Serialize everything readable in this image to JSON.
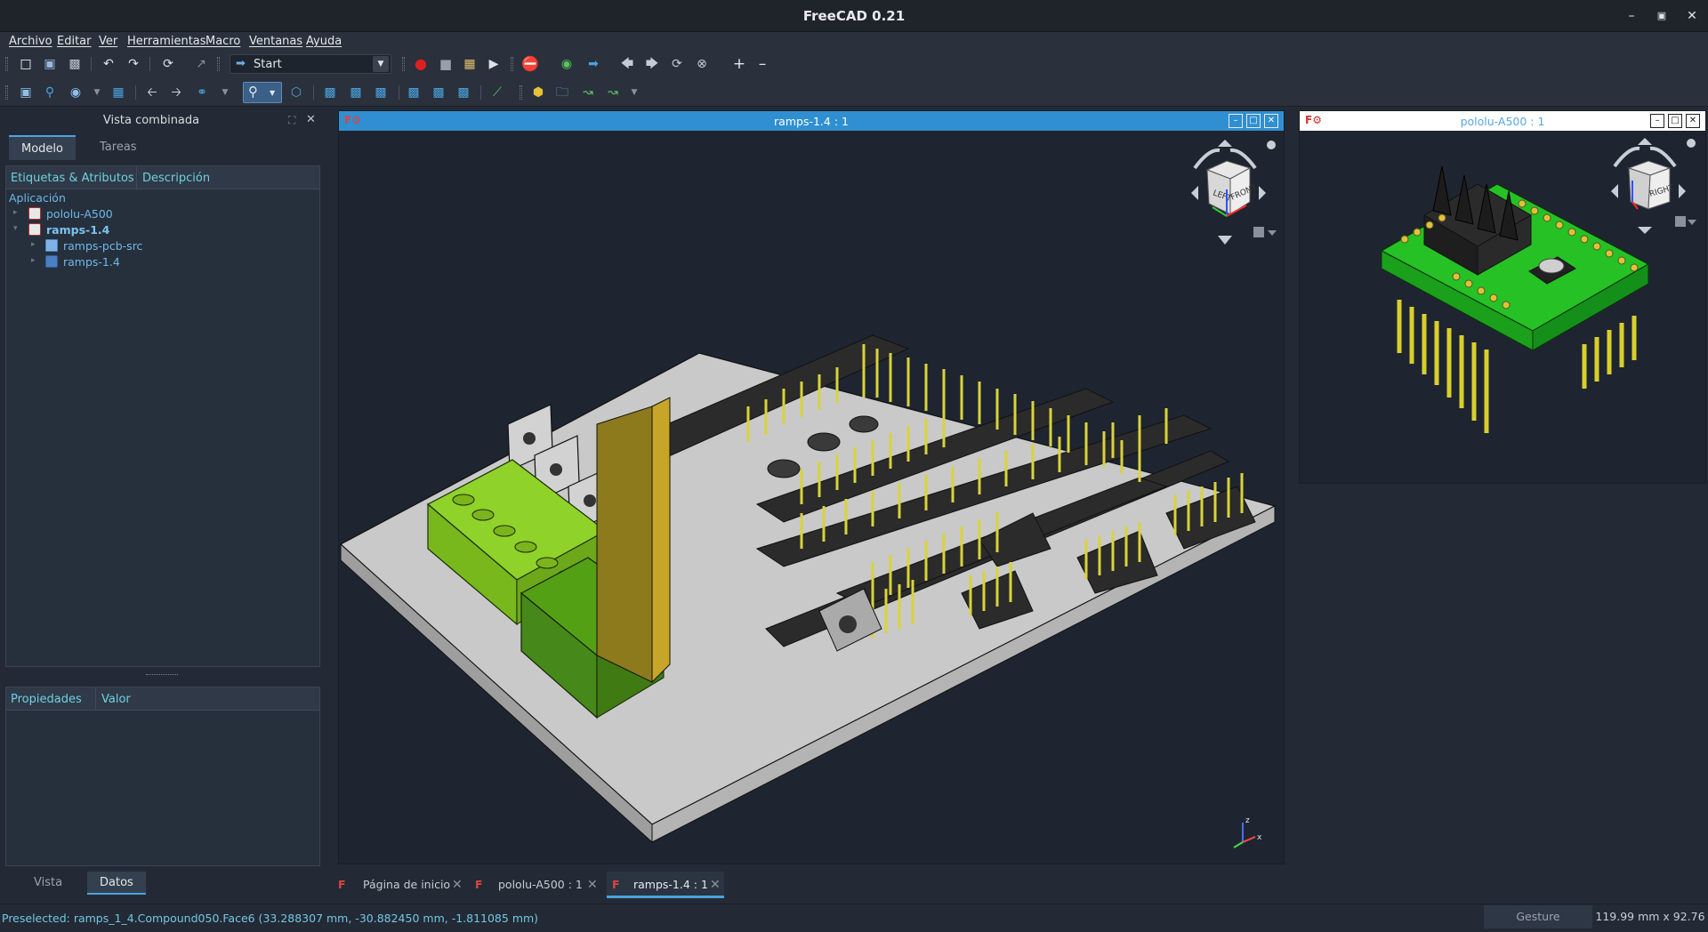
{
  "window": {
    "title": "FreeCAD 0.21"
  },
  "menu": [
    "Archivo",
    "Editar",
    "Ver",
    "Herramientas",
    "Macro",
    "Ventanas",
    "Ayuda"
  ],
  "workbench": {
    "selected": "Start"
  },
  "combo_view": {
    "title": "Vista combinada",
    "tabs": [
      "Modelo",
      "Tareas"
    ],
    "tree": {
      "columns": [
        "Etiquetas & Atributos",
        "Descripción"
      ],
      "root": "Aplicación",
      "items": [
        {
          "label": "pololu-A500",
          "bold": false
        },
        {
          "label": "ramps-1.4",
          "bold": true
        },
        {
          "label": "ramps-pcb-src"
        },
        {
          "label": "ramps-1.4"
        }
      ]
    },
    "properties": {
      "columns": [
        "Propiedades",
        "Valor"
      ]
    },
    "bottom_tabs": [
      "Vista",
      "Datos"
    ]
  },
  "views": {
    "main": {
      "title": "ramps-1.4 : 1",
      "navcube": {
        "left": "LEFT",
        "front": "FRONT"
      }
    },
    "secondary": {
      "title": "pololu-A500 : 1",
      "navcube": {
        "right": "RIGHT"
      }
    }
  },
  "doc_tabs": [
    "Página de inicio",
    "pololu-A500 : 1",
    "ramps-1.4 : 1"
  ],
  "status": {
    "message": "Preselected: ramps_1_4.Compound050.Face6 (33.288307 mm, -30.882450 mm, -1.811085 mm)",
    "nav_style": "Gesture",
    "dimensions": "119.99 mm x 92.76 mm"
  },
  "colors": {
    "accent": "#4aa3df",
    "link": "#6fb7ea",
    "pcb_main": "#c8c8c8",
    "pcb_driver": "#22c422"
  },
  "icons": {
    "axis_labels": [
      "z",
      "x"
    ]
  }
}
